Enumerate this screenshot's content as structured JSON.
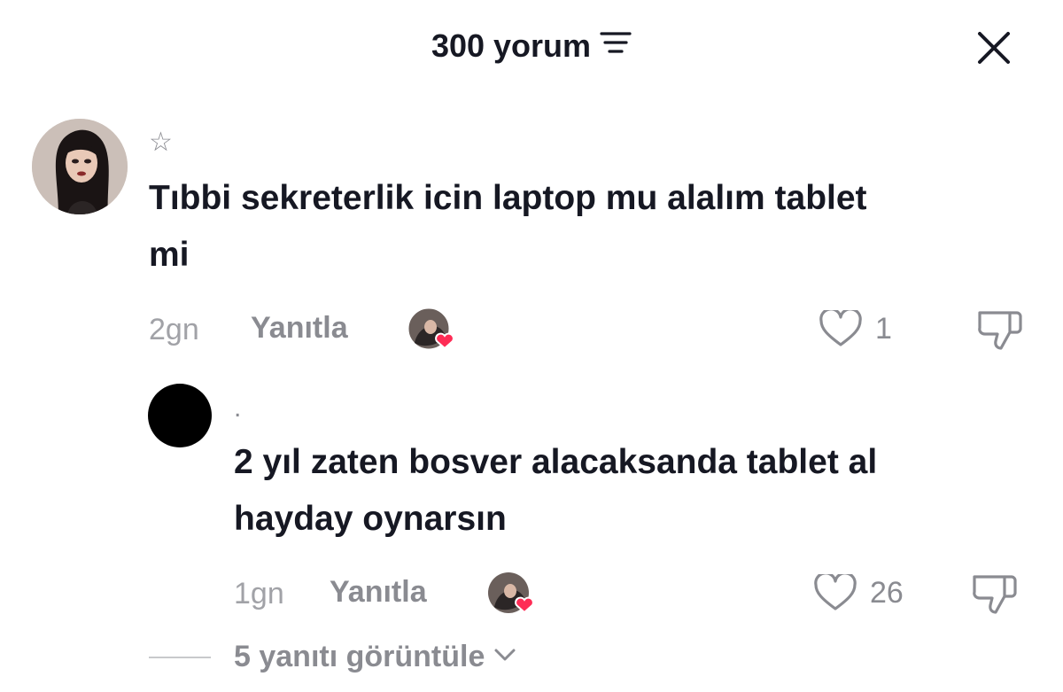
{
  "header": {
    "title": "300 yorum",
    "filter_icon": "filter-icon",
    "close_icon": "close-icon"
  },
  "comment": {
    "username": "☆",
    "text_line1": "Tıbbi sekreterlik icin laptop mu alalım tablet",
    "text_line2": "mi",
    "time": "2gn",
    "reply_label": "Yanıtla",
    "like_count": "1",
    "liked_by_creator": true
  },
  "reply": {
    "username": ".",
    "text_line1": "2 yıl zaten bosver alacaksanda tablet al",
    "text_line2": "hayday oynarsın",
    "time": "1gn",
    "reply_label": "Yanıtla",
    "like_count": "26",
    "liked_by_creator": true
  },
  "view_more": {
    "label": "5 yanıtı görüntüle"
  },
  "colors": {
    "heart": "#fe2c55",
    "text_primary": "#161823",
    "text_secondary": "#8a8b91"
  }
}
